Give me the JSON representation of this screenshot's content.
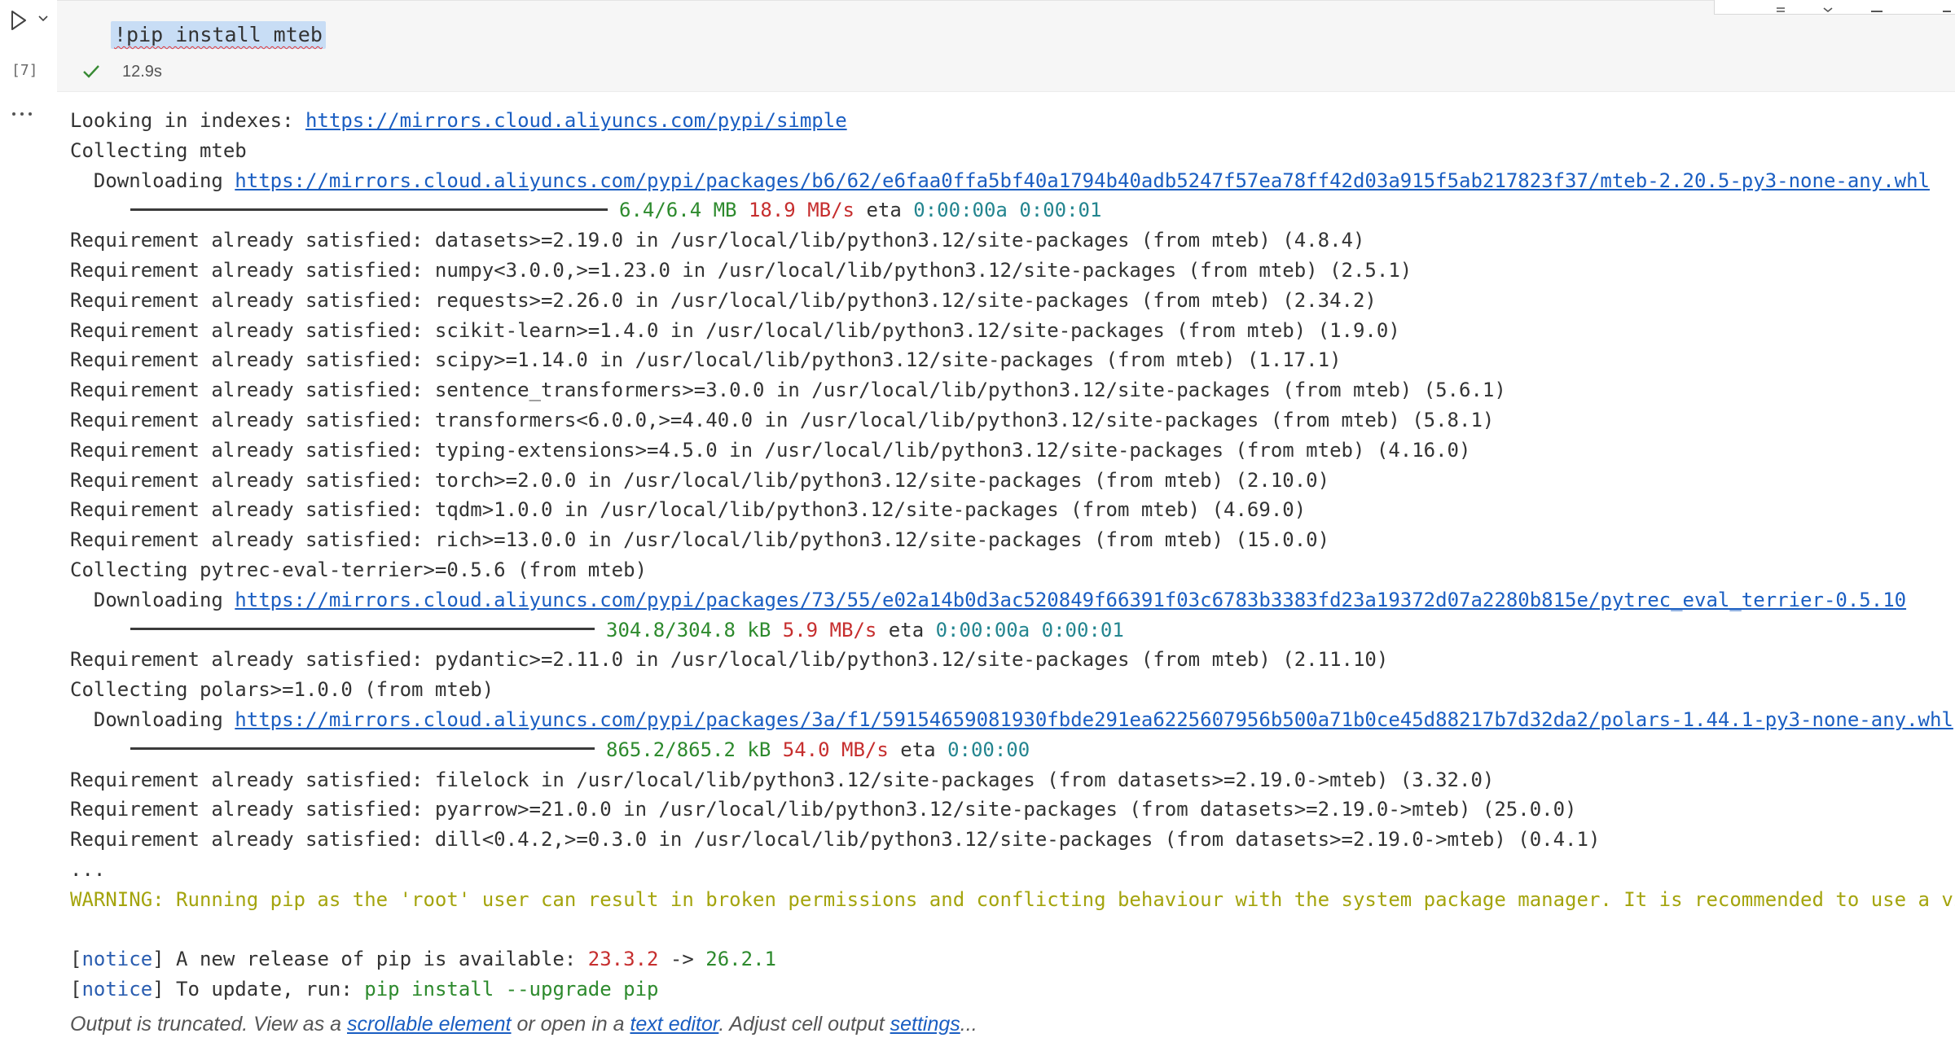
{
  "cell": {
    "execution_count": "[7]",
    "code": "!pip install mteb",
    "status": "success",
    "duration": "12.9s",
    "output_menu_label": "…"
  },
  "output": {
    "lines": [
      {
        "parts": [
          {
            "text": "Looking in indexes: "
          },
          {
            "text": "https://mirrors.cloud.aliyuncs.com/pypi/simple",
            "link": true
          }
        ]
      },
      {
        "parts": [
          {
            "text": "Collecting mteb"
          }
        ]
      },
      {
        "parts": [
          {
            "text": "  Downloading "
          },
          {
            "text": "https://mirrors.cloud.aliyuncs.com/pypi/packages/b6/62/e6faa0ffa5bf40a1794b40adb5247f57ea78ff42d03a915f5ab217823f37/mteb-2.20.5-py3-none-any.whl",
            "link": true
          }
        ]
      },
      {
        "progress": true,
        "fill": 1.0,
        "size": "6.4/6.4 MB",
        "speed": "18.9 MB/s",
        "eta_label": "eta",
        "eta": "0:00:00a",
        "eta2": "0:00:01"
      },
      {
        "parts": [
          {
            "text": "Requirement already satisfied: datasets>=2.19.0 in /usr/local/lib/python3.12/site-packages (from mteb) (4.8.4)"
          }
        ]
      },
      {
        "parts": [
          {
            "text": "Requirement already satisfied: numpy<3.0.0,>=1.23.0 in /usr/local/lib/python3.12/site-packages (from mteb) (2.5.1)"
          }
        ]
      },
      {
        "parts": [
          {
            "text": "Requirement already satisfied: requests>=2.26.0 in /usr/local/lib/python3.12/site-packages (from mteb) (2.34.2)"
          }
        ]
      },
      {
        "parts": [
          {
            "text": "Requirement already satisfied: scikit-learn>=1.4.0 in /usr/local/lib/python3.12/site-packages (from mteb) (1.9.0)"
          }
        ]
      },
      {
        "parts": [
          {
            "text": "Requirement already satisfied: scipy>=1.14.0 in /usr/local/lib/python3.12/site-packages (from mteb) (1.17.1)"
          }
        ]
      },
      {
        "parts": [
          {
            "text": "Requirement already satisfied: sentence_transformers>=3.0.0 in /usr/local/lib/python3.12/site-packages (from mteb) (5.6.1)"
          }
        ]
      },
      {
        "parts": [
          {
            "text": "Requirement already satisfied: transformers<6.0.0,>=4.40.0 in /usr/local/lib/python3.12/site-packages (from mteb) (5.8.1)"
          }
        ]
      },
      {
        "parts": [
          {
            "text": "Requirement already satisfied: typing-extensions>=4.5.0 in /usr/local/lib/python3.12/site-packages (from mteb) (4.16.0)"
          }
        ]
      },
      {
        "parts": [
          {
            "text": "Requirement already satisfied: torch>=2.0.0 in /usr/local/lib/python3.12/site-packages (from mteb) (2.10.0)"
          }
        ]
      },
      {
        "parts": [
          {
            "text": "Requirement already satisfied: tqdm>1.0.0 in /usr/local/lib/python3.12/site-packages (from mteb) (4.69.0)"
          }
        ]
      },
      {
        "parts": [
          {
            "text": "Requirement already satisfied: rich>=13.0.0 in /usr/local/lib/python3.12/site-packages (from mteb) (15.0.0)"
          }
        ]
      },
      {
        "parts": [
          {
            "text": "Collecting pytrec-eval-terrier>=0.5.6 (from mteb)"
          }
        ]
      },
      {
        "parts": [
          {
            "text": "  Downloading "
          },
          {
            "text": "https://mirrors.cloud.aliyuncs.com/pypi/packages/73/55/e02a14b0d3ac520849f66391f03c6783b3383fd23a19372d07a2280b815e/pytrec_eval_terrier-0.5.10",
            "link": true
          }
        ]
      },
      {
        "progress": true,
        "fill": 1.0,
        "size": "304.8/304.8 kB",
        "speed": "5.9 MB/s",
        "eta_label": "eta",
        "eta": "0:00:00a",
        "eta2": "0:00:01"
      },
      {
        "parts": [
          {
            "text": "Requirement already satisfied: pydantic>=2.11.0 in /usr/local/lib/python3.12/site-packages (from mteb) (2.11.10)"
          }
        ]
      },
      {
        "parts": [
          {
            "text": "Collecting polars>=1.0.0 (from mteb)"
          }
        ]
      },
      {
        "parts": [
          {
            "text": "  Downloading "
          },
          {
            "text": "https://mirrors.cloud.aliyuncs.com/pypi/packages/3a/f1/59154659081930fbde291ea6225607956b500a71b0ce45d88217b7d32da2/polars-1.44.1-py3-none-any.whl",
            "link": true
          }
        ]
      },
      {
        "progress": true,
        "fill": 1.0,
        "size": "865.2/865.2 kB",
        "speed": "54.0 MB/s",
        "eta_label": "eta",
        "eta": "0:00:00",
        "eta2": ""
      },
      {
        "parts": [
          {
            "text": "Requirement already satisfied: filelock in /usr/local/lib/python3.12/site-packages (from datasets>=2.19.0->mteb) (3.32.0)"
          }
        ]
      },
      {
        "parts": [
          {
            "text": "Requirement already satisfied: pyarrow>=21.0.0 in /usr/local/lib/python3.12/site-packages (from datasets>=2.19.0->mteb) (25.0.0)"
          }
        ]
      },
      {
        "parts": [
          {
            "text": "Requirement already satisfied: dill<0.4.2,>=0.3.0 in /usr/local/lib/python3.12/site-packages (from datasets>=2.19.0->mteb) (0.4.1)"
          }
        ]
      },
      {
        "parts": [
          {
            "text": "..."
          }
        ]
      },
      {
        "parts": [
          {
            "text": "WARNING: Running pip as the 'root' user can result in broken permissions and conflicting behaviour with the system package manager. It is recommended to use a virtual environment instead",
            "cls": "c-warn"
          }
        ]
      },
      {
        "parts": [
          {
            "text": ""
          }
        ]
      },
      {
        "parts": [
          {
            "text": "["
          },
          {
            "text": "notice",
            "cls": "c-blue"
          },
          {
            "text": "] A new release of pip is available: "
          },
          {
            "text": "23.3.2",
            "cls": "c-red"
          },
          {
            "text": " -> "
          },
          {
            "text": "26.2.1",
            "cls": "c-green"
          }
        ]
      },
      {
        "parts": [
          {
            "text": "["
          },
          {
            "text": "notice",
            "cls": "c-blue"
          },
          {
            "text": "] To update, run: "
          },
          {
            "text": "pip install --upgrade pip",
            "cls": "c-green"
          }
        ]
      }
    ]
  },
  "truncation": {
    "prefix": "Output is truncated. View as a ",
    "scrollable_link": "scrollable element",
    "middle": " or open in a ",
    "editor_link": "text editor",
    "suffix": ". Adjust cell output ",
    "settings_link": "settings",
    "ellipsis": "..."
  },
  "colors": {
    "green": "#2d8a2d",
    "red": "#c62e2e",
    "teal": "#23858f",
    "warning": "#a4a40d",
    "link": "#1a5ec2",
    "selection": "#c8ddf5"
  },
  "icons": {
    "run": "play-icon",
    "run_menu": "chevron-down-icon",
    "status": "check-icon",
    "output_menu": "ellipsis-icon"
  }
}
